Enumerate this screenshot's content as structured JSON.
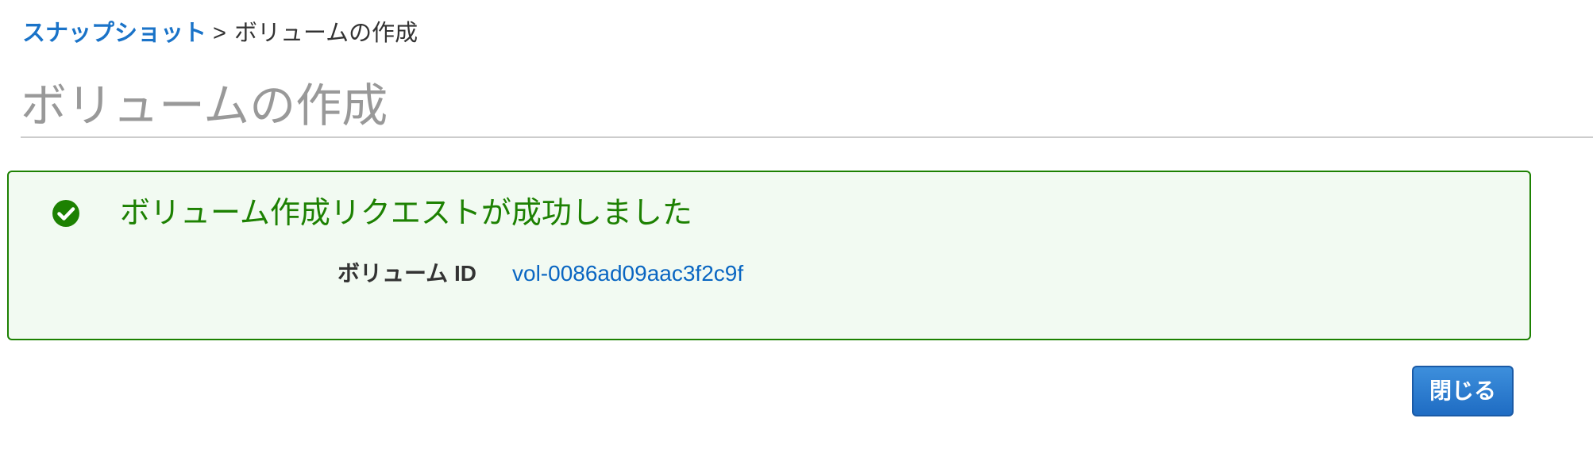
{
  "breadcrumb": {
    "parent_label": "スナップショット",
    "separator": ">",
    "current_label": "ボリュームの作成"
  },
  "page": {
    "title": "ボリュームの作成"
  },
  "alert": {
    "status": "success",
    "icon": "check-circle-icon",
    "title": "ボリューム作成リクエストが成功しました",
    "field_label": "ボリューム ID",
    "field_value": "vol-0086ad09aac3f2c9f"
  },
  "actions": {
    "close_label": "閉じる"
  },
  "colors": {
    "link": "#1a73c8",
    "success": "#1d8102",
    "success_background": "#f2faf2",
    "primary_button": "#1f6cc3",
    "title_gray": "#999999"
  }
}
